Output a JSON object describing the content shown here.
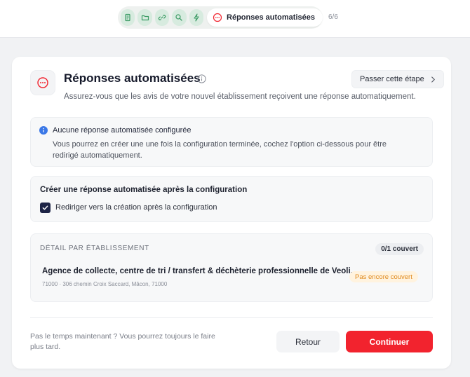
{
  "stepper": {
    "steps": [
      {
        "icon": "document-icon"
      },
      {
        "icon": "folder-icon"
      },
      {
        "icon": "link-icon"
      },
      {
        "icon": "search-icon"
      },
      {
        "icon": "lightning-icon"
      }
    ],
    "active_label": "Réponses automatisées",
    "active_icon": "chat-icon",
    "counter": "6/6",
    "accent_color": "#d7ebdf"
  },
  "header": {
    "icon": "chat-icon",
    "title": "Réponses automatisées",
    "subtitle": "Assurez-vous que les avis de votre nouvel établissement reçoivent une réponse automatiquement.",
    "skip_label": "Passer cette étape"
  },
  "info_box": {
    "title": "Aucune réponse automatisée configurée",
    "body": "Vous pourrez en créer une une fois la configuration terminée, cochez l'option ci-dessous pour être redirigé automatiquement."
  },
  "option_box": {
    "title": "Créer une réponse automatisée après la configuration",
    "checkbox_label": "Rediriger vers la création après la configuration",
    "checked": true
  },
  "detail_box": {
    "title": "DÉTAIL PAR ÉTABLISSEMENT",
    "count": "0/1 couvert",
    "establishments": [
      {
        "name": "Agence de collecte, centre de tri / transfert & déchèterie professionnelle de Veoli...",
        "address": "71000 · 306 chemin Croix Saccard, Mâcon, 71000",
        "status": "Pas encore couvert"
      }
    ]
  },
  "footer": {
    "note": "Pas le temps maintenant ? Vous pourrez toujours le faire plus tard.",
    "back_label": "Retour",
    "continue_label": "Continuer"
  },
  "colors": {
    "primary": "#f2232e",
    "navy": "#1d2446",
    "warning_bg": "#fff3df",
    "warning_text": "#e08a1e",
    "info_blue": "#3b78e7"
  }
}
